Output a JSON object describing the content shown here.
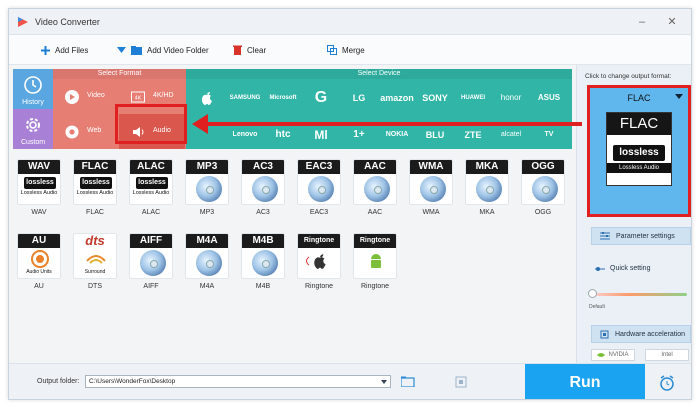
{
  "window": {
    "title": "Video Converter"
  },
  "toolbar": {
    "add_files": "Add Files",
    "add_video_folder": "Add Video Folder",
    "clear": "Clear",
    "merge": "Merge"
  },
  "categories": [
    {
      "label": "History",
      "color": "#5aa6e0"
    },
    {
      "label": "Custom",
      "color": "#a880d6"
    }
  ],
  "format_section": {
    "header": "Select Format",
    "options": [
      "Video",
      "4K/HD",
      "Web",
      "Audio"
    ]
  },
  "device_section": {
    "header": "Select Device",
    "brands_row1": [
      "",
      "SAMSUNG",
      "Microsoft",
      "G",
      "LG",
      "amazon",
      "SONY",
      "HUAWEI",
      "honor",
      "ASUS"
    ],
    "brands_row2": [
      "",
      "Lenovo",
      "htc",
      "Ml",
      "1+",
      "NOKIA",
      "BLU",
      "ZTE",
      "alcatel",
      "TV"
    ]
  },
  "formats": [
    {
      "label": "WAV",
      "caption": "WAV",
      "style": "lossless",
      "sub": "Lossless Audio"
    },
    {
      "label": "FLAC",
      "caption": "FLAC",
      "style": "lossless",
      "sub": "Lossless Audio"
    },
    {
      "label": "ALAC",
      "caption": "ALAC",
      "style": "lossless",
      "sub": "Lossless Audio"
    },
    {
      "label": "MP3",
      "caption": "MP3",
      "style": "disc"
    },
    {
      "label": "AC3",
      "caption": "AC3",
      "style": "disc"
    },
    {
      "label": "EAC3",
      "caption": "EAC3",
      "style": "disc"
    },
    {
      "label": "AAC",
      "caption": "AAC",
      "style": "disc"
    },
    {
      "label": "WMA",
      "caption": "WMA",
      "style": "disc"
    },
    {
      "label": "MKA",
      "caption": "MKA",
      "style": "disc"
    },
    {
      "label": "OGG",
      "caption": "OGG",
      "style": "disc"
    },
    {
      "label": "AU",
      "caption": "AU",
      "style": "au",
      "sub": "Audio Units"
    },
    {
      "label": "dts",
      "caption": "DTS",
      "style": "dts",
      "sub": "Surround"
    },
    {
      "label": "AIFF",
      "caption": "AIFF",
      "style": "disc"
    },
    {
      "label": "M4A",
      "caption": "M4A",
      "style": "disc"
    },
    {
      "label": "M4B",
      "caption": "M4B",
      "style": "disc"
    },
    {
      "label": "Ringtone",
      "caption": "Ringtone",
      "style": "ringtone-apple"
    },
    {
      "label": "Ringtone",
      "caption": "Ringtone",
      "style": "ringtone-android"
    }
  ],
  "output": {
    "hint": "Click to change output format:",
    "format": "FLAC",
    "card_head": "FLAC",
    "card_badge": "lossless",
    "card_sub": "Lossless Audio"
  },
  "settings": {
    "parameter": "Parameter settings",
    "quick": "Quick setting",
    "default_label": "Default",
    "hardware": "Hardware acceleration",
    "gpu_nvidia": "NVIDIA",
    "gpu_intel": "Intel"
  },
  "bottom": {
    "output_folder_label": "Output folder:",
    "output_folder_value": "C:\\Users\\WonderFox\\Desktop",
    "run": "Run"
  },
  "colors": {
    "accent": "#1aa3f0",
    "format_red": "#e77e74",
    "device_teal": "#30b5a6",
    "highlight": "#e02020"
  }
}
